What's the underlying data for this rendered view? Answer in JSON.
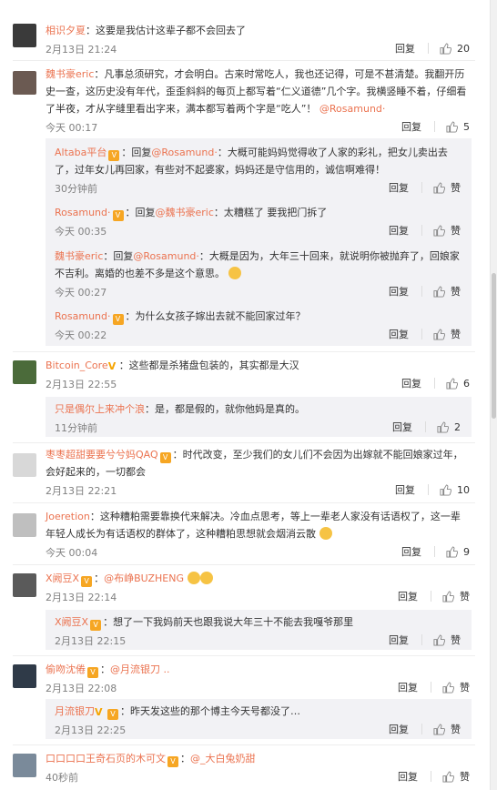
{
  "comments": [
    {
      "user": "相识夕夏",
      "text": "：这要是我估计这辈子都不会回去了",
      "time": "2月13日 21:24",
      "reply": "回复",
      "likes": "20"
    },
    {
      "user": "魏书豪eric",
      "text": "：凡事总须研究，才会明白。古来时常吃人，我也还记得，可是不甚清楚。我翻开历史一查，这历史没有年代，歪歪斜斜的每页上都写着“仁义道德”几个字。我横竖睡不着，仔细看了半夜，才从字缝里看出字来，满本都写着两个字是“吃人”！",
      "mention": "@Rosamund·",
      "time": "今天 00:17",
      "reply": "回复",
      "likes": "5"
    },
    {
      "user": "Bitcoin_Core",
      "text": "：这些都是杀猪盘包装的，其实都是大汉",
      "time": "2月13日 22:55",
      "reply": "回复",
      "likes": "6"
    },
    {
      "user": "枣枣超甜要要兮兮妈QAQ",
      "text": "：时代改变，至少我们的女儿们不会因为出嫁就不能回娘家过年，会好起来的，一切都会",
      "time": "2月13日 22:21",
      "reply": "回复",
      "likes": "10"
    },
    {
      "user": "Joeretion",
      "text": "：这种糟粕需要靠换代来解决。冷血点思考，等上一辈老人家没有话语权了，这一辈年轻人成长为有话语权的群体了，这种糟粕思想就会烟消云散",
      "time": "今天 00:04",
      "reply": "回复",
      "likes": "9"
    },
    {
      "user": "X阙豆X",
      "text": "：",
      "mention": "@布峥BUZHENG",
      "time": "2月13日 22:14",
      "reply": "回复",
      "likes": "赞"
    },
    {
      "user": "偷吻沈倦",
      "text": "：",
      "mention": "@月流银刀 ..",
      "time": "2月13日 22:08",
      "reply": "回复",
      "likes": "赞"
    },
    {
      "user": "口口口口王奇石页的木可文",
      "text": "：",
      "mention": "@_大白兔奶甜",
      "time": "40秒前",
      "reply": "回复",
      "likes": "赞"
    }
  ],
  "replies": [
    {
      "user": "Altaba平台",
      "pre": "：回复",
      "mention": "@Rosamund·",
      "text": "：大概可能妈妈觉得收了人家的彩礼，把女儿卖出去了，过年女儿再回家，有些对不起婆家，妈妈还是守信用的，诚信啊难得！",
      "time": "30分钟前",
      "reply": "回复",
      "likes": "赞"
    },
    {
      "user": "Rosamund·",
      "pre": "：回复",
      "mention": "@魏书豪eric",
      "text": "：太糟糕了 要我把门拆了",
      "time": "今天 00:35",
      "reply": "回复",
      "likes": "赞"
    },
    {
      "user": "魏书豪eric",
      "pre": "：回复",
      "mention": "@Rosamund·",
      "text": "：大概是因为，大年三十回来，就说明你被抛弃了，回娘家不吉利。离婚的也差不多是这个意思。",
      "time": "今天 00:27",
      "reply": "回复",
      "likes": "赞"
    },
    {
      "user": "Rosamund·",
      "pre": "",
      "mention": "",
      "text": "：为什么女孩子嫁出去就不能回家过年？",
      "time": "今天 00:22",
      "reply": "回复",
      "likes": "赞"
    },
    {
      "user": "只是偶尔上来冲个浪",
      "pre": "",
      "mention": "",
      "text": "：是，都是假的，就你他妈是真的。",
      "time": "11分钟前",
      "reply": "回复",
      "likes": "2"
    },
    {
      "user": "X阙豆X",
      "pre": "",
      "mention": "",
      "text": "：想了一下我妈前天也跟我说大年三十不能去我嘎爷那里",
      "time": "2月13日 22:15",
      "reply": "回复",
      "likes": "赞"
    },
    {
      "user": "月流银刀",
      "pre": "",
      "mention": "",
      "text": "：昨天发这些的那个博主今天号都没了…",
      "time": "2月13日 22:25",
      "reply": "回复",
      "likes": "赞"
    }
  ]
}
